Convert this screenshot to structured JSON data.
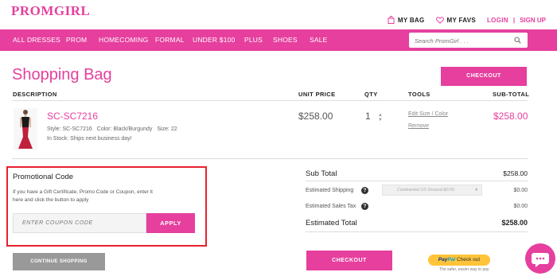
{
  "brand": {
    "logo": "PROMGIRL"
  },
  "header": {
    "my_bag": "MY BAG",
    "my_favs": "MY FAVS",
    "login": "LOGIN",
    "separator": "|",
    "sign_up": "SIGN UP"
  },
  "nav": {
    "items": [
      "ALL DRESSES",
      "PROM",
      "HOMECOMING",
      "FORMAL",
      "UNDER $100",
      "PLUS",
      "SHOES",
      "SALE"
    ],
    "search_placeholder": "Search PromGirl . . ."
  },
  "page": {
    "title": "Shopping Bag",
    "checkout_label": "CHECKOUT"
  },
  "columns": {
    "description": "DESCRIPTION",
    "unit_price": "UNIT PRICE",
    "qty": "QTY",
    "tools": "TOOLS",
    "sub_total": "SUB-TOTAL"
  },
  "item": {
    "name": "SC-SC7216",
    "style": "Style: SC-SC7216",
    "color": "Color: Black/Burgundy",
    "size": "Size: 22",
    "stock": "In Stock: Ships next business day!",
    "unit_price": "$258.00",
    "qty": "1",
    "edit_link": "Edit Size / Color",
    "remove_link": "Remove",
    "subtotal": "$258.00"
  },
  "promo": {
    "title": "Promotional Code",
    "description": "If you have a Gift Certificate, Promo Code or Coupon, enter it here and click the button to apply",
    "placeholder": "ENTER COUPON CODE",
    "apply_label": "APPLY"
  },
  "continue_label": "CONTINUE SHOPPING",
  "summary": {
    "sub_total_label": "Sub Total",
    "sub_total_value": "$258.00",
    "shipping_label": "Estimated Shipping",
    "shipping_option": "Continental US Ground $0.00",
    "shipping_value": "$0.00",
    "tax_label": "Estimated Sales Tax",
    "tax_value": "$0.00",
    "total_label": "Estimated Total",
    "total_value": "$258.00"
  },
  "paypal": {
    "pay": "Pay",
    "pal": "Pal",
    "checkout": "Check out",
    "tagline": "The safer, easier way to pay"
  },
  "colors": {
    "brand_pink": "#e63f9e",
    "highlight_red": "#e8202f",
    "gray_button": "#999999",
    "paypal_yellow": "#ffc439"
  },
  "icons": {
    "bag": "shopping-bag-icon",
    "favs": "heart-icon",
    "search": "search-icon",
    "help": "question-icon",
    "chat": "chat-icon"
  }
}
